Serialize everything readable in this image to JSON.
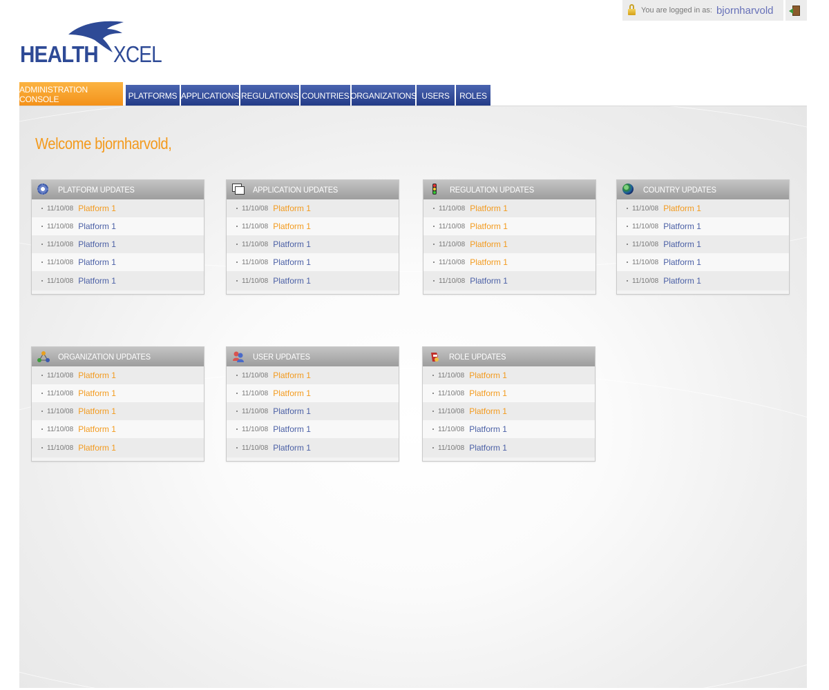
{
  "login": {
    "label": "You are logged in as:",
    "username": "bjornharvold"
  },
  "logo": {
    "part1": "HEALTH",
    "part2": "XCEL"
  },
  "nav": {
    "tabs": [
      {
        "label": "ADMINISTRATION CONSOLE",
        "active": true
      },
      {
        "label": "PLATFORMS"
      },
      {
        "label": "APPLICATIONS"
      },
      {
        "label": "REGULATIONS"
      },
      {
        "label": "COUNTRIES"
      },
      {
        "label": "ORGANIZATIONS"
      },
      {
        "label": "USERS"
      },
      {
        "label": "ROLES"
      }
    ]
  },
  "welcome": "Welcome bjornharvold,",
  "panels": [
    {
      "title": "PLATFORM UPDATES",
      "icon": "gear-icon",
      "items": [
        {
          "date": "11/10/08",
          "text": "Platform 1",
          "color": "orange"
        },
        {
          "date": "11/10/08",
          "text": "Platform 1",
          "color": "blue"
        },
        {
          "date": "11/10/08",
          "text": "Platform 1",
          "color": "blue"
        },
        {
          "date": "11/10/08",
          "text": "Platform 1",
          "color": "blue"
        },
        {
          "date": "11/10/08",
          "text": "Platform 1",
          "color": "blue"
        }
      ]
    },
    {
      "title": "APPLICATION UPDATES",
      "icon": "windows-icon",
      "items": [
        {
          "date": "11/10/08",
          "text": "Platform 1",
          "color": "orange"
        },
        {
          "date": "11/10/08",
          "text": "Platform 1",
          "color": "orange"
        },
        {
          "date": "11/10/08",
          "text": "Platform 1",
          "color": "blue"
        },
        {
          "date": "11/10/08",
          "text": "Platform 1",
          "color": "blue"
        },
        {
          "date": "11/10/08",
          "text": "Platform 1",
          "color": "blue"
        }
      ]
    },
    {
      "title": "REGULATION UPDATES",
      "icon": "traffic-light-icon",
      "items": [
        {
          "date": "11/10/08",
          "text": "Platform 1",
          "color": "orange"
        },
        {
          "date": "11/10/08",
          "text": "Platform 1",
          "color": "orange"
        },
        {
          "date": "11/10/08",
          "text": "Platform 1",
          "color": "orange"
        },
        {
          "date": "11/10/08",
          "text": "Platform 1",
          "color": "orange"
        },
        {
          "date": "11/10/08",
          "text": "Platform 1",
          "color": "blue"
        }
      ]
    },
    {
      "title": "COUNTRY UPDATES",
      "icon": "globe-icon",
      "items": [
        {
          "date": "11/10/08",
          "text": "Platform 1",
          "color": "orange"
        },
        {
          "date": "11/10/08",
          "text": "Platform 1",
          "color": "blue"
        },
        {
          "date": "11/10/08",
          "text": "Platform 1",
          "color": "blue"
        },
        {
          "date": "11/10/08",
          "text": "Platform 1",
          "color": "blue"
        },
        {
          "date": "11/10/08",
          "text": "Platform 1",
          "color": "blue"
        }
      ]
    },
    {
      "title": "ORGANIZATION UPDATES",
      "icon": "organization-icon",
      "items": [
        {
          "date": "11/10/08",
          "text": "Platform 1",
          "color": "orange"
        },
        {
          "date": "11/10/08",
          "text": "Platform 1",
          "color": "orange"
        },
        {
          "date": "11/10/08",
          "text": "Platform 1",
          "color": "orange"
        },
        {
          "date": "11/10/08",
          "text": "Platform 1",
          "color": "orange"
        },
        {
          "date": "11/10/08",
          "text": "Platform 1",
          "color": "orange"
        }
      ]
    },
    {
      "title": "USER UPDATES",
      "icon": "users-icon",
      "items": [
        {
          "date": "11/10/08",
          "text": "Platform 1",
          "color": "orange"
        },
        {
          "date": "11/10/08",
          "text": "Platform 1",
          "color": "orange"
        },
        {
          "date": "11/10/08",
          "text": "Platform 1",
          "color": "blue"
        },
        {
          "date": "11/10/08",
          "text": "Platform 1",
          "color": "blue"
        },
        {
          "date": "11/10/08",
          "text": "Platform 1",
          "color": "blue"
        }
      ]
    },
    {
      "title": "ROLE UPDATES",
      "icon": "role-icon",
      "items": [
        {
          "date": "11/10/08",
          "text": "Platform 1",
          "color": "orange"
        },
        {
          "date": "11/10/08",
          "text": "Platform 1",
          "color": "orange"
        },
        {
          "date": "11/10/08",
          "text": "Platform 1",
          "color": "orange"
        },
        {
          "date": "11/10/08",
          "text": "Platform 1",
          "color": "blue"
        },
        {
          "date": "11/10/08",
          "text": "Platform 1",
          "color": "blue"
        }
      ]
    }
  ],
  "colors": {
    "brand_blue": "#2e4a96",
    "nav_blue": "#223a86",
    "accent_orange": "#f39a1d",
    "link_blue": "#4a5fa5"
  }
}
